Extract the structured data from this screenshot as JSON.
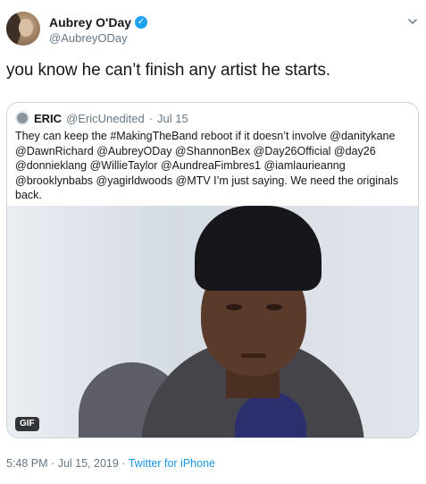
{
  "author": {
    "display_name": "Aubrey O'Day",
    "handle": "@AubreyODay",
    "verified": true
  },
  "tweet": {
    "text": "you know he can’t finish any artist he starts."
  },
  "quoted_tweet": {
    "display_name": "ERIC",
    "handle": "@EricUnedited",
    "separator": "·",
    "date": "Jul 15",
    "text": "They can keep the #MakingTheBand reboot if it doesn’t involve @danitykane @DawnRichard @AubreyODay @ShannonBex @Day26Official @day26 @donnieklang @WillieTaylor @AundreaFimbres1 @iamlaurieanng @brooklynbabs @yagirldwoods @MTV I’m just saying. We need the originals back.",
    "media_badge": "GIF"
  },
  "meta": {
    "time": "5:48 PM",
    "date": "Jul 15, 2019",
    "separator": "·",
    "source": "Twitter for iPhone"
  },
  "colors": {
    "text": "#14171a",
    "secondary": "#657786",
    "link": "#1b95e0",
    "verified": "#1da1f2",
    "border": "#ccd6dd"
  },
  "icons": {
    "verified": "verified-badge-icon",
    "menu": "chevron-down-icon"
  }
}
